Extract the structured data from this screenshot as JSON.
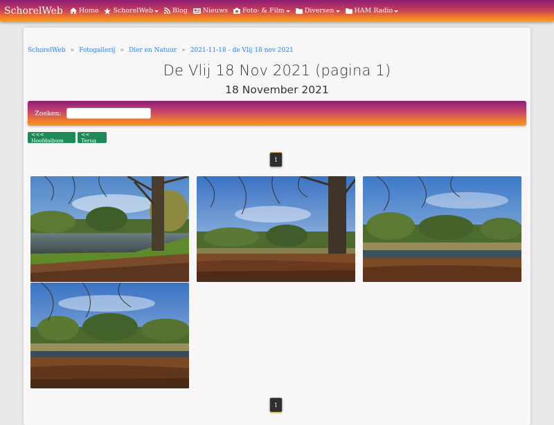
{
  "nav": {
    "brand": "SchorelWeb",
    "items": [
      {
        "label": "Home",
        "icon": "home-icon",
        "dropdown": false
      },
      {
        "label": "SchorelWeb",
        "icon": "star-icon",
        "dropdown": true
      },
      {
        "label": "Blog",
        "icon": "rss-icon",
        "dropdown": false
      },
      {
        "label": "Nieuws",
        "icon": "newspaper-icon",
        "dropdown": false
      },
      {
        "label": "Foto- & Film",
        "icon": "camera-icon",
        "dropdown": true
      },
      {
        "label": "Diversen",
        "icon": "folder-icon",
        "dropdown": true
      },
      {
        "label": "HAM Radio",
        "icon": "folder-icon",
        "dropdown": true
      }
    ]
  },
  "breadcrumb": [
    "SchorelWeb",
    "Fotogallerij",
    "Dier en Natuur",
    "2021-11-18 - de Vlij 18 nov 2021"
  ],
  "breadcrumb_separator": "»",
  "page": {
    "title": "De Vlij 18 Nov 2021 (pagina 1)",
    "subtitle": "18 November 2021"
  },
  "search": {
    "label": "Zoeken:",
    "value": "",
    "placeholder": ""
  },
  "buttons": {
    "main_album": "<<< Hoofdalbum",
    "back": "<< Terug"
  },
  "pagination": {
    "current_page": "1"
  },
  "photos": [
    {
      "name": "photo-1"
    },
    {
      "name": "photo-2"
    },
    {
      "name": "photo-3"
    },
    {
      "name": "photo-4"
    }
  ],
  "colors": {
    "navbar_top": "#8e1d77",
    "navbar_bottom": "#f39b24",
    "link": "#2b7fe6",
    "button_green": "#1e8a57",
    "page_bg": "#e9e7ea",
    "card_bg": "#f8f6f7"
  }
}
